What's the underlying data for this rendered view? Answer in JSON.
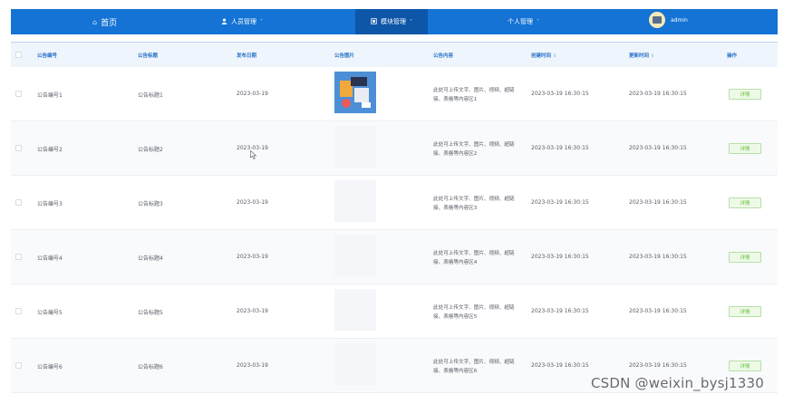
{
  "nav": {
    "home_label": "首页",
    "home_icon": "home-icon",
    "users_label": "人员管理",
    "users_icon": "user-icon",
    "modules_label": "模块管理",
    "modules_icon": "module-icon",
    "personal_label": "个人管理",
    "chevron": "˅",
    "user_name": "admin",
    "accent_color": "#1473d4"
  },
  "table": {
    "headers": {
      "number": "公告编号",
      "title": "公告标题",
      "date": "发布日期",
      "image": "公告图片",
      "content": "公告内容",
      "created": "创建时间",
      "updated": "更新时间",
      "action": "操作"
    },
    "sort_icon": "⇕",
    "rows": [
      {
        "number": "公告编号1",
        "title": "公告标题1",
        "date": "2023-03-19",
        "content": "此处可上传文字、图片、视频、超链接、表格等内容区1",
        "created": "2023-03-19 16:30:15",
        "updated": "2023-03-19 16:30:15",
        "action": "详情"
      },
      {
        "number": "公告编号2",
        "title": "公告标题2",
        "date": "2023-03-19",
        "content": "此处可上传文字、图片、视频、超链接、表格等内容区2",
        "created": "2023-03-19 16:30:15",
        "updated": "2023-03-19 16:30:15",
        "action": "详情"
      },
      {
        "number": "公告编号3",
        "title": "公告标题3",
        "date": "2023-03-19",
        "content": "此处可上传文字、图片、视频、超链接、表格等内容区3",
        "created": "2023-03-19 16:30:15",
        "updated": "2023-03-19 16:30:15",
        "action": "详情"
      },
      {
        "number": "公告编号4",
        "title": "公告标题4",
        "date": "2023-03-19",
        "content": "此处可上传文字、图片、视频、超链接、表格等内容区4",
        "created": "2023-03-19 16:30:15",
        "updated": "2023-03-19 16:30:15",
        "action": "详情"
      },
      {
        "number": "公告编号5",
        "title": "公告标题5",
        "date": "2023-03-19",
        "content": "此处可上传文字、图片、视频、超链接、表格等内容区5",
        "created": "2023-03-19 16:30:15",
        "updated": "2023-03-19 16:30:15",
        "action": "详情"
      },
      {
        "number": "公告编号6",
        "title": "公告标题6",
        "date": "2023-03-19",
        "content": "此处可上传文字、图片、视频、超链接、表格等内容区6",
        "created": "2023-03-19 16:30:15",
        "updated": "2023-03-19 16:30:15",
        "action": "详情"
      }
    ]
  },
  "watermark": "CSDN @weixin_bysj1330"
}
